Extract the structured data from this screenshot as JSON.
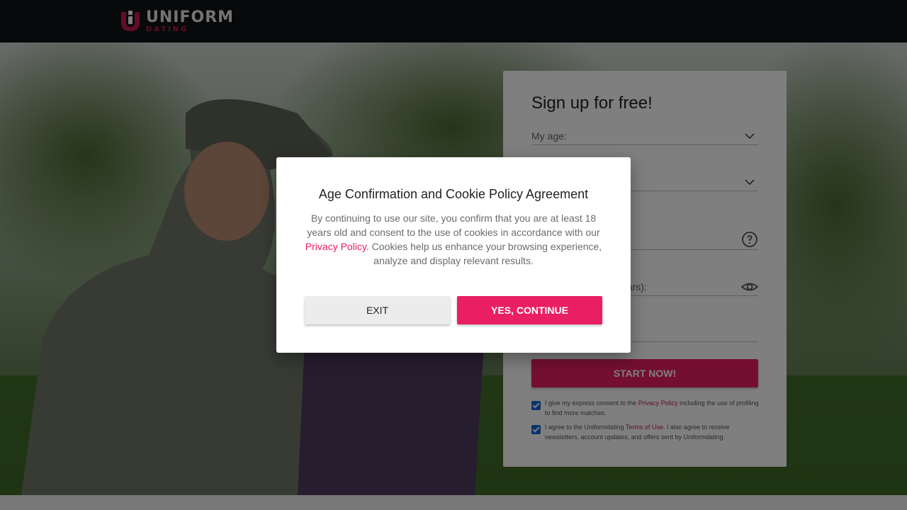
{
  "header": {
    "logo_word": "UNIFORM",
    "logo_sub": "DATING",
    "brand_color": "#c4184f"
  },
  "signup": {
    "title": "Sign up for free!",
    "fields": [
      {
        "label": "My age:",
        "icon": "chevron-down-icon"
      },
      {
        "label": "",
        "icon": "chevron-down-icon"
      },
      {
        "label": "",
        "icon": "help-circle-icon"
      },
      {
        "label": "chars):",
        "icon": "eye-icon"
      },
      {
        "label": "",
        "icon": ""
      }
    ],
    "start_button": "START NOW!",
    "consent_1": {
      "before": "I give my express consent to the ",
      "link": "Privacy Policy",
      "after": " including the use of profiling to find more matches."
    },
    "consent_2": {
      "before": "I agree to the Uniformdating ",
      "link": "Terms of Use",
      "after": ". I also agree to receive newsletters, account updates, and offers sent by Uniformdating."
    }
  },
  "modal": {
    "title": "Age Confirmation and Cookie Policy Agreement",
    "body_before": "By continuing to use our site, you confirm that you are at least 18 years old and consent to the use of cookies in accordance with our ",
    "body_link": "Privacy Policy",
    "body_after": ". Cookies help us enhance your browsing experience, analyze and display relevant results.",
    "exit_label": "EXIT",
    "continue_label": "YES, CONTINUE",
    "accent_color": "#e91e63"
  }
}
